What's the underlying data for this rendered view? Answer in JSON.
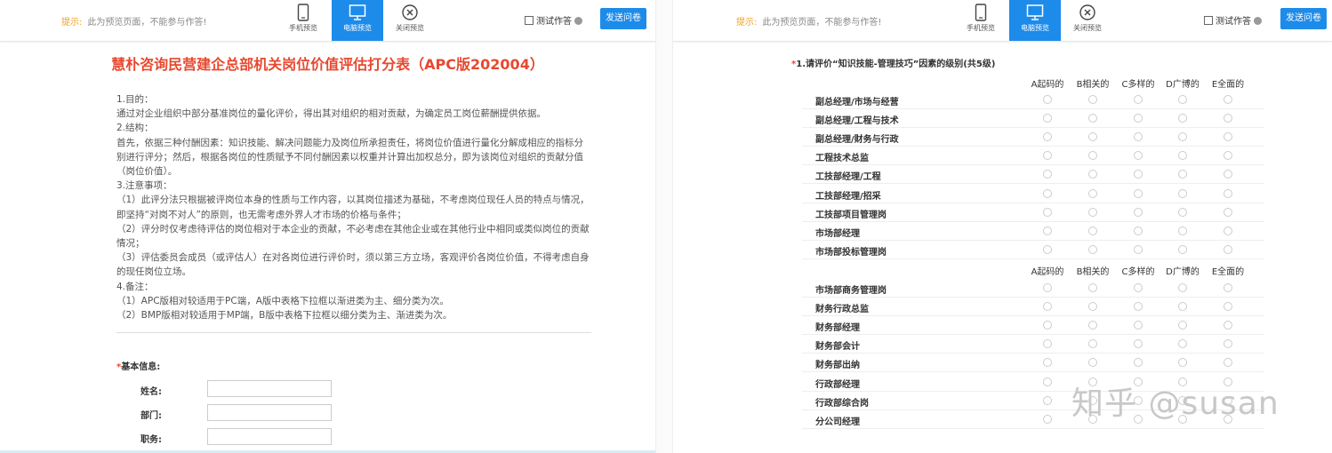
{
  "topbar": {
    "hint_label": "提示:",
    "hint_text": "此为预览页面，不能参与作答!",
    "modes": [
      "手机预览",
      "电脑预览",
      "关闭预览"
    ],
    "test_option": "测试作答",
    "send_button": "发送问卷"
  },
  "survey": {
    "title": "慧朴咨询民营建企总部机关岗位价值评估打分表（APC版202004）",
    "intro": [
      "1.目的：",
      "通过对企业组织中部分基准岗位的量化评价，得出其对组织的相对贡献，为确定员工岗位薪酬提供依据。",
      "2.结构：",
      "首先，依据三种付酬因素：知识技能、解决问题能力及岗位所承担责任，将岗位价值进行量化分解成相应的指标分别进行评分；然后，根据各岗位的性质赋予不同付酬因素以权重并计算出加权总分，即为该岗位对组织的贡献分值（岗位价值）。",
      "3.注意事项：",
      "（1）此评分法只根据被评岗位本身的性质与工作内容，以其岗位描述为基础，不考虑岗位现任人员的特点与情况，即坚持“对岗不对人”的原则，也无需考虑外界人才市场的价格与条件；",
      "（2）评分时仅考虑待评估的岗位相对于本企业的贡献，不必考虑在其他企业或在其他行业中相同或类似岗位的贡献情况；",
      "（3）评估委员会成员（或评估人）在对各岗位进行评价时，须以第三方立场，客观评价各岗位价值，不得考虑自身的现任岗位立场。",
      "4.备注：",
      "（1）APC版相对较适用于PC端，A版中表格下拉框以渐进类为主、细分类为次。",
      "（2）BMP版相对较适用于MP端，B版中表格下拉框以细分类为主、渐进类为次。"
    ],
    "basic_info": {
      "required_mark": "*",
      "title": "基本信息:",
      "fields": [
        {
          "label": "姓名:",
          "value": ""
        },
        {
          "label": "部门:",
          "value": ""
        },
        {
          "label": "职务:",
          "value": ""
        }
      ]
    }
  },
  "question": {
    "required_mark": "*",
    "title": "1.请评价“知识技能-管理技巧”因素的级别(共5级)",
    "columns": [
      "A起码的",
      "B相关的",
      "C多样的",
      "D广博的",
      "E全面的"
    ],
    "rows_group1": [
      "副总经理/市场与经营",
      "副总经理/工程与技术",
      "副总经理/财务与行政",
      "工程技术总监",
      "工技部经理/工程",
      "工技部经理/招采",
      "工技部项目管理岗",
      "市场部经理",
      "市场部投标管理岗"
    ],
    "rows_group2": [
      "市场部商务管理岗",
      "财务行政总监",
      "财务部经理",
      "财务部会计",
      "财务部出纳",
      "行政部经理",
      "行政部综合岗",
      "分公司经理"
    ]
  },
  "watermark": "知乎 @susan"
}
